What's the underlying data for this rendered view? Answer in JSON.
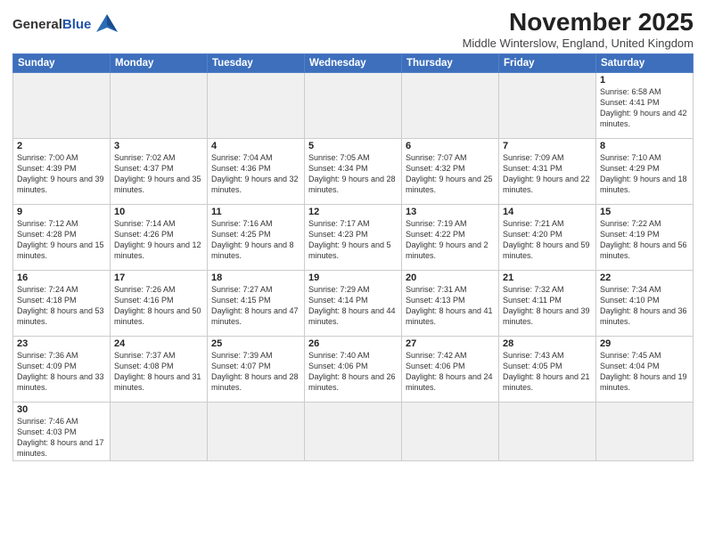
{
  "logo": {
    "text_general": "General",
    "text_blue": "Blue"
  },
  "header": {
    "month": "November 2025",
    "location": "Middle Winterslow, England, United Kingdom"
  },
  "days_of_week": [
    "Sunday",
    "Monday",
    "Tuesday",
    "Wednesday",
    "Thursday",
    "Friday",
    "Saturday"
  ],
  "weeks": [
    [
      {
        "num": "",
        "info": ""
      },
      {
        "num": "",
        "info": ""
      },
      {
        "num": "",
        "info": ""
      },
      {
        "num": "",
        "info": ""
      },
      {
        "num": "",
        "info": ""
      },
      {
        "num": "",
        "info": ""
      },
      {
        "num": "1",
        "info": "Sunrise: 6:58 AM\nSunset: 4:41 PM\nDaylight: 9 hours and 42 minutes."
      }
    ],
    [
      {
        "num": "2",
        "info": "Sunrise: 7:00 AM\nSunset: 4:39 PM\nDaylight: 9 hours and 39 minutes."
      },
      {
        "num": "3",
        "info": "Sunrise: 7:02 AM\nSunset: 4:37 PM\nDaylight: 9 hours and 35 minutes."
      },
      {
        "num": "4",
        "info": "Sunrise: 7:04 AM\nSunset: 4:36 PM\nDaylight: 9 hours and 32 minutes."
      },
      {
        "num": "5",
        "info": "Sunrise: 7:05 AM\nSunset: 4:34 PM\nDaylight: 9 hours and 28 minutes."
      },
      {
        "num": "6",
        "info": "Sunrise: 7:07 AM\nSunset: 4:32 PM\nDaylight: 9 hours and 25 minutes."
      },
      {
        "num": "7",
        "info": "Sunrise: 7:09 AM\nSunset: 4:31 PM\nDaylight: 9 hours and 22 minutes."
      },
      {
        "num": "8",
        "info": "Sunrise: 7:10 AM\nSunset: 4:29 PM\nDaylight: 9 hours and 18 minutes."
      }
    ],
    [
      {
        "num": "9",
        "info": "Sunrise: 7:12 AM\nSunset: 4:28 PM\nDaylight: 9 hours and 15 minutes."
      },
      {
        "num": "10",
        "info": "Sunrise: 7:14 AM\nSunset: 4:26 PM\nDaylight: 9 hours and 12 minutes."
      },
      {
        "num": "11",
        "info": "Sunrise: 7:16 AM\nSunset: 4:25 PM\nDaylight: 9 hours and 8 minutes."
      },
      {
        "num": "12",
        "info": "Sunrise: 7:17 AM\nSunset: 4:23 PM\nDaylight: 9 hours and 5 minutes."
      },
      {
        "num": "13",
        "info": "Sunrise: 7:19 AM\nSunset: 4:22 PM\nDaylight: 9 hours and 2 minutes."
      },
      {
        "num": "14",
        "info": "Sunrise: 7:21 AM\nSunset: 4:20 PM\nDaylight: 8 hours and 59 minutes."
      },
      {
        "num": "15",
        "info": "Sunrise: 7:22 AM\nSunset: 4:19 PM\nDaylight: 8 hours and 56 minutes."
      }
    ],
    [
      {
        "num": "16",
        "info": "Sunrise: 7:24 AM\nSunset: 4:18 PM\nDaylight: 8 hours and 53 minutes."
      },
      {
        "num": "17",
        "info": "Sunrise: 7:26 AM\nSunset: 4:16 PM\nDaylight: 8 hours and 50 minutes."
      },
      {
        "num": "18",
        "info": "Sunrise: 7:27 AM\nSunset: 4:15 PM\nDaylight: 8 hours and 47 minutes."
      },
      {
        "num": "19",
        "info": "Sunrise: 7:29 AM\nSunset: 4:14 PM\nDaylight: 8 hours and 44 minutes."
      },
      {
        "num": "20",
        "info": "Sunrise: 7:31 AM\nSunset: 4:13 PM\nDaylight: 8 hours and 41 minutes."
      },
      {
        "num": "21",
        "info": "Sunrise: 7:32 AM\nSunset: 4:11 PM\nDaylight: 8 hours and 39 minutes."
      },
      {
        "num": "22",
        "info": "Sunrise: 7:34 AM\nSunset: 4:10 PM\nDaylight: 8 hours and 36 minutes."
      }
    ],
    [
      {
        "num": "23",
        "info": "Sunrise: 7:36 AM\nSunset: 4:09 PM\nDaylight: 8 hours and 33 minutes."
      },
      {
        "num": "24",
        "info": "Sunrise: 7:37 AM\nSunset: 4:08 PM\nDaylight: 8 hours and 31 minutes."
      },
      {
        "num": "25",
        "info": "Sunrise: 7:39 AM\nSunset: 4:07 PM\nDaylight: 8 hours and 28 minutes."
      },
      {
        "num": "26",
        "info": "Sunrise: 7:40 AM\nSunset: 4:06 PM\nDaylight: 8 hours and 26 minutes."
      },
      {
        "num": "27",
        "info": "Sunrise: 7:42 AM\nSunset: 4:06 PM\nDaylight: 8 hours and 24 minutes."
      },
      {
        "num": "28",
        "info": "Sunrise: 7:43 AM\nSunset: 4:05 PM\nDaylight: 8 hours and 21 minutes."
      },
      {
        "num": "29",
        "info": "Sunrise: 7:45 AM\nSunset: 4:04 PM\nDaylight: 8 hours and 19 minutes."
      }
    ],
    [
      {
        "num": "30",
        "info": "Sunrise: 7:46 AM\nSunset: 4:03 PM\nDaylight: 8 hours and 17 minutes."
      },
      {
        "num": "",
        "info": ""
      },
      {
        "num": "",
        "info": ""
      },
      {
        "num": "",
        "info": ""
      },
      {
        "num": "",
        "info": ""
      },
      {
        "num": "",
        "info": ""
      },
      {
        "num": "",
        "info": ""
      }
    ]
  ]
}
